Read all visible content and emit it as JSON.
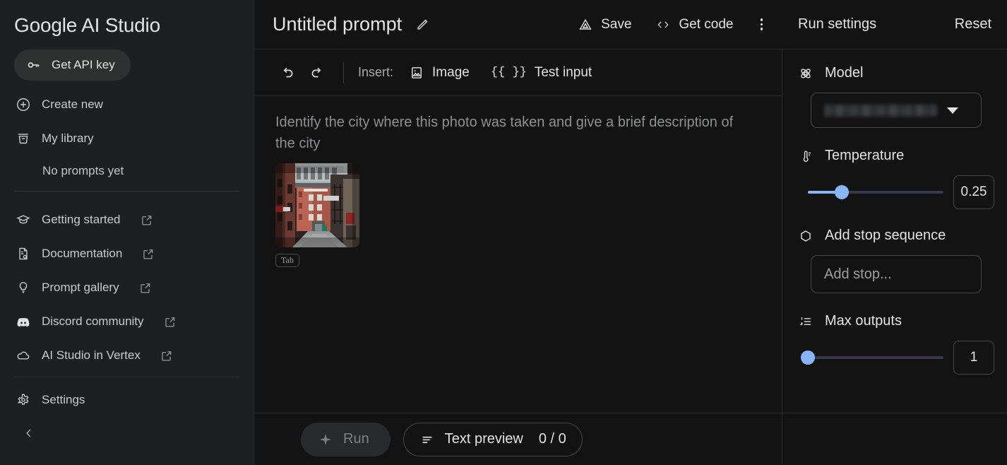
{
  "app": {
    "brand": "Google AI Studio"
  },
  "sidebar": {
    "api_key_button": "Get API key",
    "items": [
      {
        "label": "Create new",
        "icon": "plus-circle-icon",
        "external": false
      },
      {
        "label": "My library",
        "icon": "library-icon",
        "external": false
      }
    ],
    "empty_state": "No prompts yet",
    "links": [
      {
        "label": "Getting started",
        "icon": "graduation-cap-icon",
        "external": true
      },
      {
        "label": "Documentation",
        "icon": "document-search-icon",
        "external": true
      },
      {
        "label": "Prompt gallery",
        "icon": "lightbulb-icon",
        "external": true
      },
      {
        "label": "Discord community",
        "icon": "discord-icon",
        "external": true
      },
      {
        "label": "AI Studio in Vertex",
        "icon": "cloud-icon",
        "external": true
      }
    ],
    "settings": {
      "label": "Settings",
      "icon": "gear-icon"
    },
    "collapse": {
      "icon": "chevron-left-icon"
    }
  },
  "header": {
    "title": "Untitled prompt",
    "edit_icon": "pencil-icon",
    "actions": [
      {
        "label": "Save",
        "icon": "drive-save-icon"
      },
      {
        "label": "Get code",
        "icon": "code-brackets-icon"
      }
    ],
    "more_icon": "kebab-menu-icon"
  },
  "toolbar": {
    "undo_icon": "undo-icon",
    "redo_icon": "redo-icon",
    "insert_label": "Insert:",
    "insert_items": [
      {
        "label": "Image",
        "icon": "image-icon"
      },
      {
        "label": "Test input",
        "icon": "double-braces-icon"
      }
    ],
    "braces_glyph": "{{ }}"
  },
  "editor": {
    "prompt_text": "Identify the city where this photo was taken and give a brief description of the city",
    "attachment": {
      "name": "street-photo-thumbnail",
      "alt": "Narrow urban street lined with red brick buildings and fire escapes"
    },
    "tab_hint": "Tab"
  },
  "footer": {
    "run_label": "Run",
    "run_icon": "sparkle-icon",
    "preview_label": "Text preview",
    "preview_icon": "text-lines-icon",
    "token_count": "0 / 0"
  },
  "run_settings": {
    "title": "Run settings",
    "reset_label": "Reset",
    "model": {
      "label": "Model",
      "icon": "model-atom-icon",
      "value": "",
      "redacted": true,
      "caret_icon": "caret-down-icon"
    },
    "temperature": {
      "label": "Temperature",
      "icon": "thermometer-icon",
      "value": "0.25",
      "min": 0,
      "max": 1,
      "fill_percent": 25
    },
    "stop_sequence": {
      "label": "Add stop sequence",
      "icon": "hexagon-icon",
      "placeholder": "Add stop..."
    },
    "max_outputs": {
      "label": "Max outputs",
      "icon": "numbered-list-icon",
      "value": "1",
      "min": 1,
      "max": 8,
      "fill_percent": 0
    }
  },
  "colors": {
    "accent": "#8ab4f8",
    "sidebar_bg": "#1e1f20",
    "main_bg": "#131314",
    "text_primary": "#e3e3e3",
    "text_secondary": "#9a9b9c",
    "border": "#2c2d2f"
  }
}
